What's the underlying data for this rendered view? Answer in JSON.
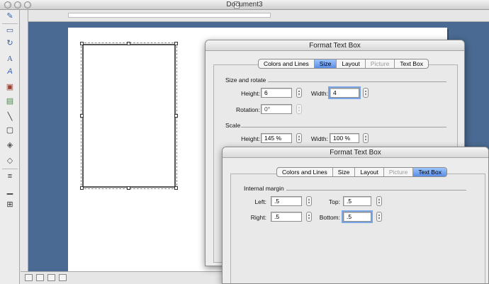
{
  "window": {
    "title": "Document3"
  },
  "toolbox": {
    "icons": [
      "formatting-palette-icon",
      "selection-icon",
      "rotate-icon",
      "text-box-icon",
      "wordart-icon",
      "clip-art-icon",
      "picture-icon",
      "line-icon",
      "rectangle-icon",
      "autoshapes-icon",
      "fill-color-icon",
      "line-style-icon",
      "line-color-icon",
      "font-color-icon"
    ]
  },
  "dialog_size": {
    "title": "Format Text Box",
    "tabs": [
      {
        "label": "Colors and Lines",
        "state": "normal"
      },
      {
        "label": "Size",
        "state": "selected"
      },
      {
        "label": "Layout",
        "state": "normal"
      },
      {
        "label": "Picture",
        "state": "disabled"
      },
      {
        "label": "Text Box",
        "state": "normal"
      }
    ],
    "size_rotate_heading": "Size and rotate",
    "height_label": "Height:",
    "height_value": "6",
    "width_label": "Width:",
    "width_value": "4",
    "rotation_label": "Rotation:",
    "rotation_value": "0°",
    "scale_heading": "Scale",
    "scale_height_label": "Height:",
    "scale_height_value": "145 %",
    "scale_width_label": "Width:",
    "scale_width_value": "100 %"
  },
  "dialog_textbox": {
    "title": "Format Text Box",
    "tabs": [
      {
        "label": "Colors and Lines",
        "state": "normal"
      },
      {
        "label": "Size",
        "state": "normal"
      },
      {
        "label": "Layout",
        "state": "normal"
      },
      {
        "label": "Picture",
        "state": "disabled"
      },
      {
        "label": "Text Box",
        "state": "selected"
      }
    ],
    "internal_margin_heading": "Internal margin",
    "left_label": "Left:",
    "left_value": ".5",
    "top_label": "Top:",
    "top_value": ".5",
    "right_label": "Right:",
    "right_value": ".5",
    "bottom_label": "Bottom:",
    "bottom_value": ".5"
  },
  "colors": {
    "canvas": "#4a6a93",
    "selected_tab": "#5b8ee6"
  }
}
